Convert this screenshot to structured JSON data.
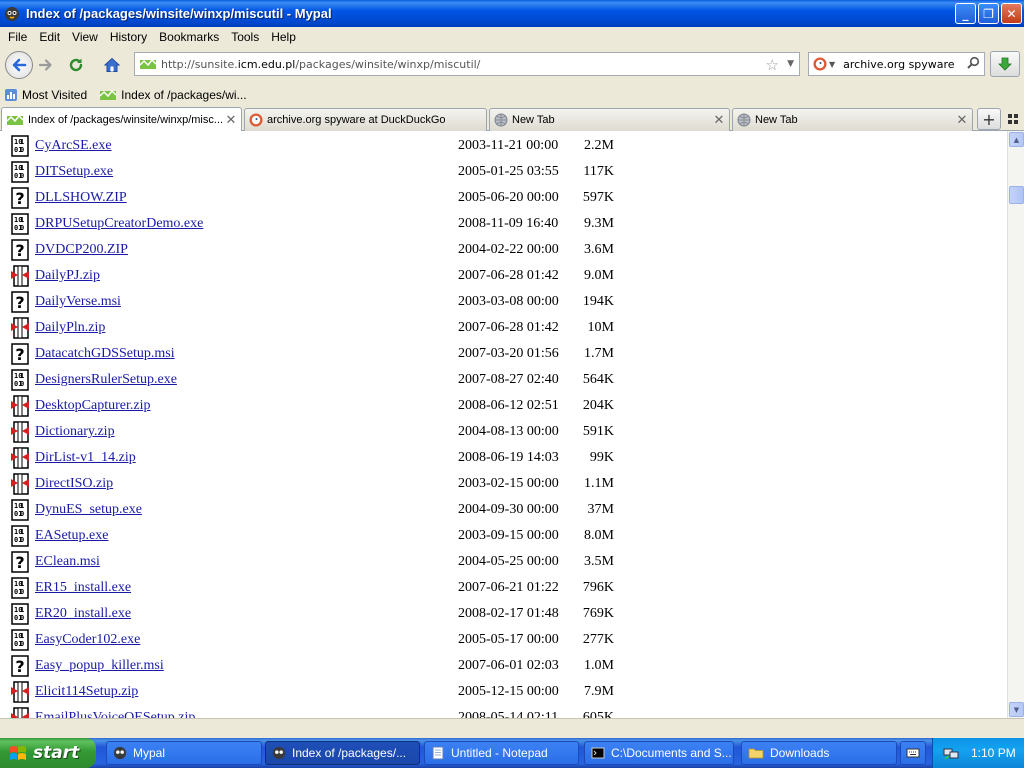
{
  "window": {
    "title": "Index of /packages/winsite/winxp/miscutil - Mypal",
    "buttons": {
      "minimize": "_",
      "maximize": "❐",
      "close": "✕"
    }
  },
  "menu": [
    "File",
    "Edit",
    "View",
    "History",
    "Bookmarks",
    "Tools",
    "Help"
  ],
  "nav": {
    "url_prefix": "http://sunsite.",
    "url_host": "icm.edu.pl",
    "url_path": "/packages/winsite/winxp/miscutil/",
    "search_value": "archive.org spyware"
  },
  "bookmarks": [
    {
      "label": "Most Visited",
      "icon": "most-visited-icon"
    },
    {
      "label": "Index of /packages/wi...",
      "icon": "site-icon"
    }
  ],
  "tabs": [
    {
      "label": "Index of /packages/winsite/winxp/misc...",
      "active": true,
      "icon": "site-icon"
    },
    {
      "label": "archive.org spyware at DuckDuckGo",
      "active": false,
      "icon": "duckduckgo-icon"
    },
    {
      "label": "New Tab",
      "active": false,
      "icon": "globe-icon"
    },
    {
      "label": "New Tab",
      "active": false,
      "icon": "globe-icon"
    }
  ],
  "files": [
    {
      "name": "CyArcSE.exe",
      "date": "2003-11-21 00:00",
      "size": "2.2M",
      "type": "exe"
    },
    {
      "name": "DITSetup.exe",
      "date": "2005-01-25 03:55",
      "size": "117K",
      "type": "exe"
    },
    {
      "name": "DLLSHOW.ZIP",
      "date": "2005-06-20 00:00",
      "size": "597K",
      "type": "unknown"
    },
    {
      "name": "DRPUSetupCreatorDemo.exe",
      "date": "2008-11-09 16:40",
      "size": "9.3M",
      "type": "exe"
    },
    {
      "name": "DVDCP200.ZIP",
      "date": "2004-02-22 00:00",
      "size": "3.6M",
      "type": "unknown"
    },
    {
      "name": "DailyPJ.zip",
      "date": "2007-06-28 01:42",
      "size": "9.0M",
      "type": "zip"
    },
    {
      "name": "DailyVerse.msi",
      "date": "2003-03-08 00:00",
      "size": "194K",
      "type": "unknown"
    },
    {
      "name": "DailyPln.zip",
      "date": "2007-06-28 01:42",
      "size": "10M",
      "type": "zip"
    },
    {
      "name": "DatacatchGDSSetup.msi",
      "date": "2007-03-20 01:56",
      "size": "1.7M",
      "type": "unknown"
    },
    {
      "name": "DesignersRulerSetup.exe",
      "date": "2007-08-27 02:40",
      "size": "564K",
      "type": "exe"
    },
    {
      "name": "DesktopCapturer.zip",
      "date": "2008-06-12 02:51",
      "size": "204K",
      "type": "zip"
    },
    {
      "name": "Dictionary.zip",
      "date": "2004-08-13 00:00",
      "size": "591K",
      "type": "zip"
    },
    {
      "name": "DirList-v1_14.zip",
      "date": "2008-06-19 14:03",
      "size": "99K",
      "type": "zip"
    },
    {
      "name": "DirectISO.zip",
      "date": "2003-02-15 00:00",
      "size": "1.1M",
      "type": "zip"
    },
    {
      "name": "DynuES_setup.exe",
      "date": "2004-09-30 00:00",
      "size": "37M",
      "type": "exe"
    },
    {
      "name": "EASetup.exe",
      "date": "2003-09-15 00:00",
      "size": "8.0M",
      "type": "exe"
    },
    {
      "name": "EClean.msi",
      "date": "2004-05-25 00:00",
      "size": "3.5M",
      "type": "unknown"
    },
    {
      "name": "ER15_install.exe",
      "date": "2007-06-21 01:22",
      "size": "796K",
      "type": "exe"
    },
    {
      "name": "ER20_install.exe",
      "date": "2008-02-17 01:48",
      "size": "769K",
      "type": "exe"
    },
    {
      "name": "EasyCoder102.exe",
      "date": "2005-05-17 00:00",
      "size": "277K",
      "type": "exe"
    },
    {
      "name": "Easy_popup_killer.msi",
      "date": "2007-06-01 02:03",
      "size": "1.0M",
      "type": "unknown"
    },
    {
      "name": "Elicit114Setup.zip",
      "date": "2005-12-15 00:00",
      "size": "7.9M",
      "type": "zip"
    },
    {
      "name": "EmailPlusVoiceOESetup.zip",
      "date": "2008-05-14 02:11",
      "size": "605K",
      "type": "zip"
    }
  ],
  "taskbar": {
    "start_label": "start",
    "tasks": [
      {
        "label": "Mypal",
        "active": false,
        "icon": "mypal-icon"
      },
      {
        "label": "Index of /packages/...",
        "active": true,
        "icon": "mypal-icon"
      },
      {
        "label": "Untitled - Notepad",
        "active": false,
        "icon": "notepad-icon"
      },
      {
        "label": "C:\\Documents and S...",
        "active": false,
        "icon": "cmd-icon"
      },
      {
        "label": "Downloads",
        "active": false,
        "icon": "folder-icon"
      }
    ],
    "clock": "1:10 PM"
  }
}
